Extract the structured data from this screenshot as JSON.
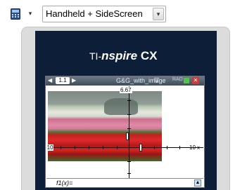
{
  "toolbar": {
    "view_icon": "calculator-icon",
    "dropdown_arrow": "▾",
    "view_select": "Handheld + SideScreen",
    "select_arrow": "▾"
  },
  "device": {
    "brand_ti": "TI-",
    "brand_nspire": "nspire",
    "brand_cx": " CX"
  },
  "screen": {
    "tab_label": "1.1",
    "prev_arrow": "◀",
    "next_arrow": "▶",
    "doc_title": "G&G_with_image",
    "doc_arrow": "▽",
    "rad_label": "RAD",
    "close_symbol": "✕",
    "graph": {
      "xmin_label": "-10",
      "xmax_label": "10",
      "ymax_label": "6.67",
      "axis_arrow": "x"
    },
    "entry": {
      "text": "f1(x)=",
      "button_symbol": "▲"
    }
  }
}
